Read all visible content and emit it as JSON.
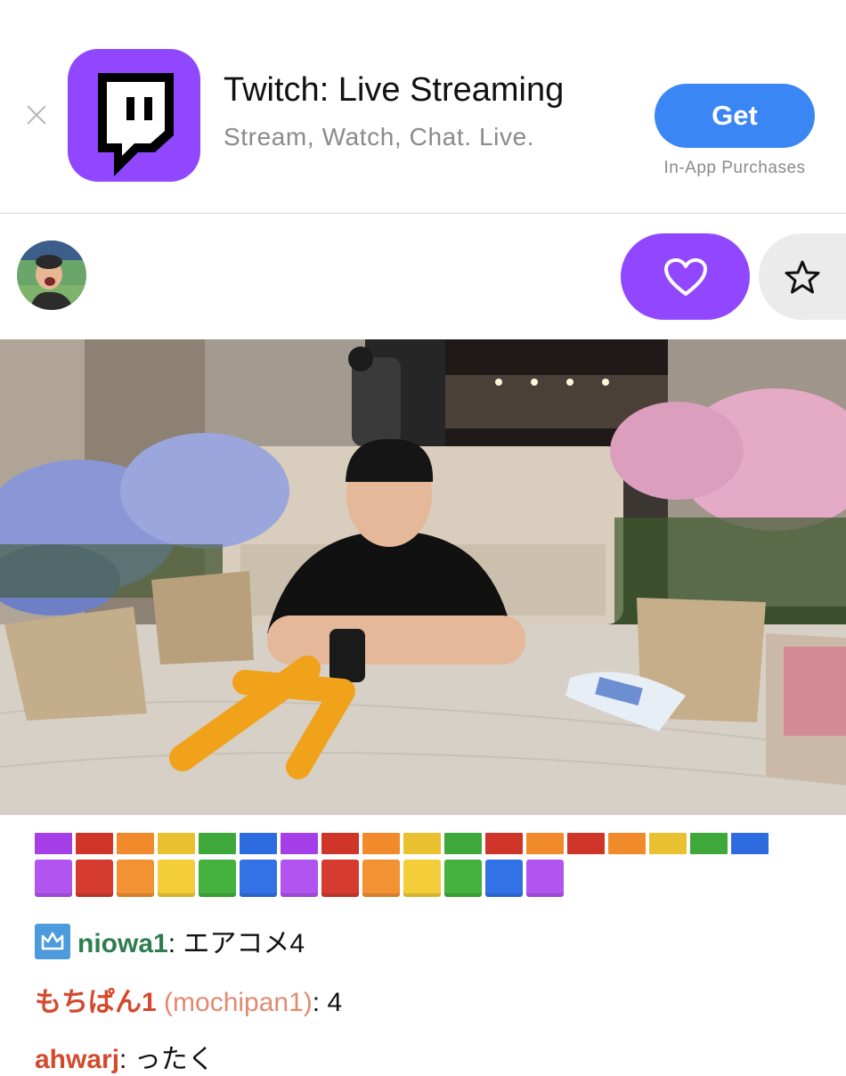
{
  "banner": {
    "app_title": "Twitch: Live Streaming",
    "app_subtitle": "Stream, Watch, Chat. Live.",
    "get_label": "Get",
    "iap_note": "In-App Purchases",
    "icon": "twitch-logo-icon",
    "brand_color": "#9147ff"
  },
  "channel": {
    "follow_icon": "heart-icon",
    "favorite_icon": "star-icon",
    "accent_color": "#9147ff"
  },
  "chat": {
    "emote_colors_row1": [
      "#a43ee6",
      "#d0352a",
      "#f08a2a",
      "#e9c130",
      "#3fa83a",
      "#2c6be0",
      "#a43ee6",
      "#d0352a",
      "#f08a2a",
      "#e9c130",
      "#3fa83a",
      "#d0352a",
      "#f08a2a",
      "#d0352a",
      "#f08a2a",
      "#e9c130",
      "#3fa83a",
      "#2c6be0"
    ],
    "emote_colors_row2": [
      "#b154f0",
      "#d63b2f",
      "#f39233",
      "#f3cd3a",
      "#43b13c",
      "#3272e6",
      "#b154f0",
      "#d63b2f",
      "#f39233",
      "#f3cd3a",
      "#43b13c",
      "#3272e6",
      "#b154f0"
    ],
    "messages": [
      {
        "badge": "crown-icon",
        "username": "niowa1",
        "login": "",
        "separator": ":",
        "text": " エアコメ4",
        "color": "#2e7d4f"
      },
      {
        "badge": "",
        "username": "もちぱん1",
        "login": " (mochipan1)",
        "separator": ":",
        "text": "  4",
        "color": "#d44a2c"
      },
      {
        "badge": "",
        "username": "ahwarj",
        "login": "",
        "separator": ":",
        "text": " ったく",
        "color": "#d44a2c"
      }
    ]
  }
}
